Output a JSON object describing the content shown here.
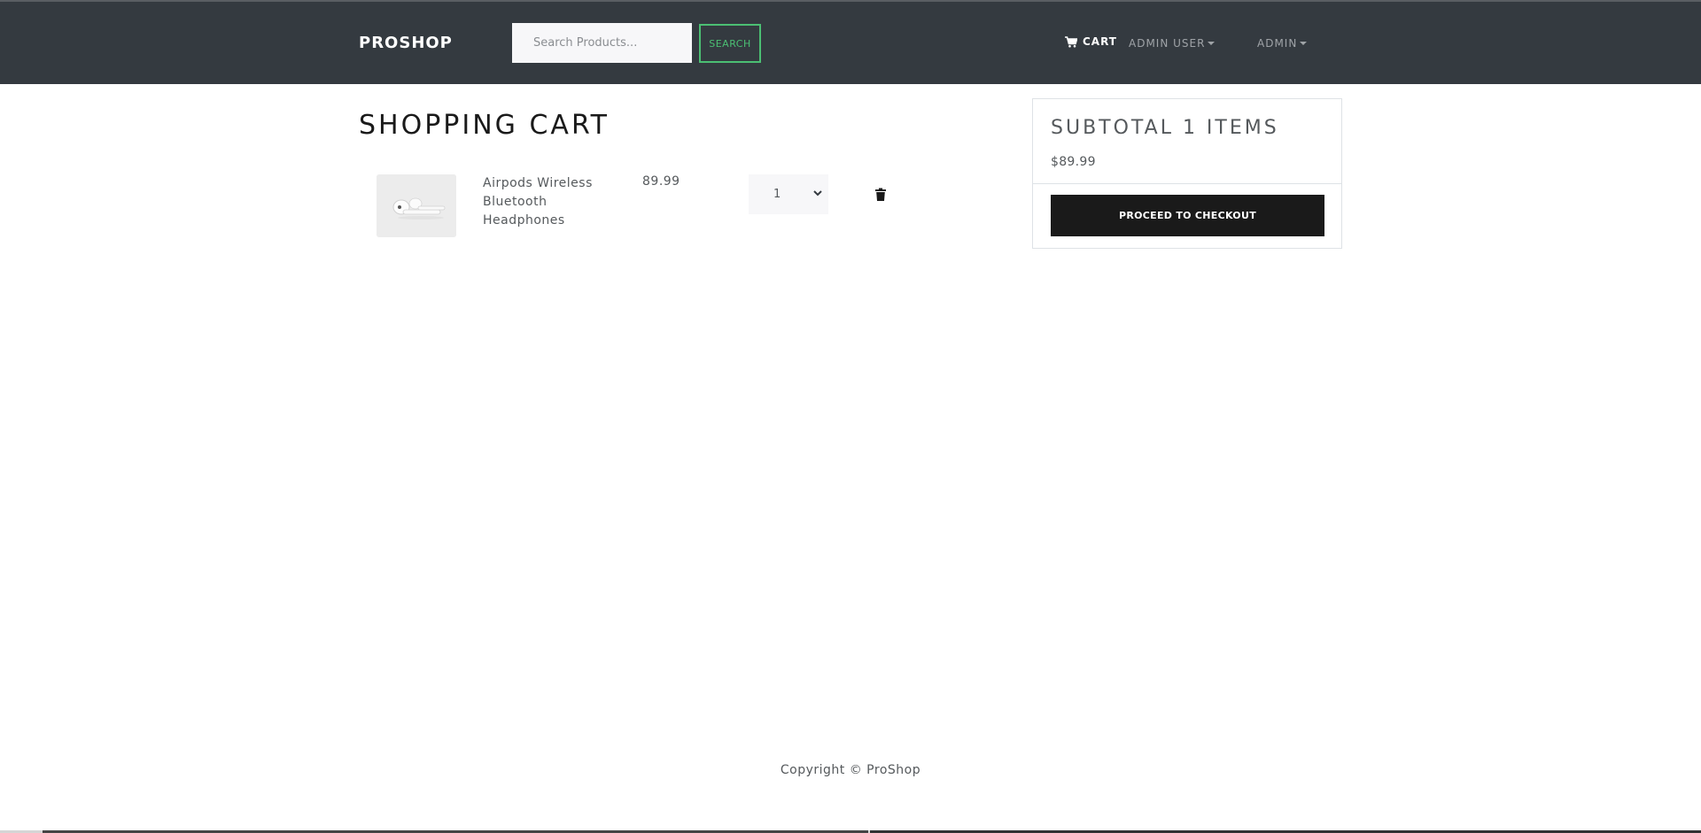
{
  "navbar": {
    "brand": "PROSHOP",
    "search_placeholder": "Search Products...",
    "search_button": "SEARCH",
    "cart_label": "CART",
    "user_menu": "ADMIN USER",
    "admin_menu": "ADMIN"
  },
  "page": {
    "title": "SHOPPING CART"
  },
  "cart_items": [
    {
      "name": "Airpods Wireless Bluetooth Headphones",
      "price": "89.99",
      "quantity": "1"
    }
  ],
  "summary": {
    "title": "SUBTOTAL 1 ITEMS",
    "total": "$89.99",
    "checkout_button": "PROCEED TO CHECKOUT"
  },
  "footer": {
    "copyright": "Copyright © ProShop"
  },
  "colors": {
    "navbar_bg": "#343a40",
    "accent_green": "#4bbf73",
    "button_dark": "#1a1a1a"
  },
  "icons": [
    "shopping-cart-icon",
    "caret-down-icon",
    "chevron-down-icon",
    "trash-icon"
  ]
}
